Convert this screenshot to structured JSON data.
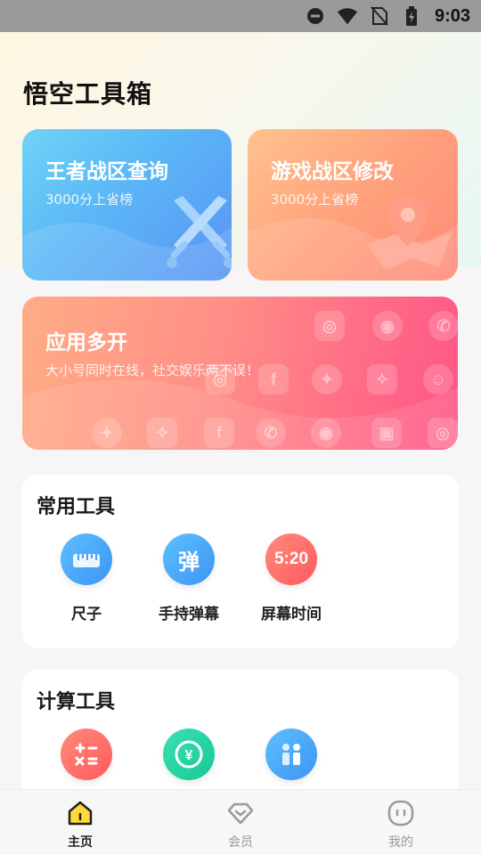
{
  "status_bar": {
    "time": "9:03"
  },
  "app": {
    "title": "悟空工具箱"
  },
  "cards": {
    "king": {
      "title": "王者战区查询",
      "subtitle": "3000分上省榜"
    },
    "game": {
      "title": "游戏战区修改",
      "subtitle": "3000分上省榜"
    },
    "multi": {
      "title": "应用多开",
      "subtitle": "大小号同时在线，社交娱乐两不误！"
    }
  },
  "sections": {
    "common": {
      "title": "常用工具",
      "tools": [
        {
          "label": "尺子",
          "icon": "ruler-icon",
          "color": "#4aa8f7"
        },
        {
          "label": "手持弹幕",
          "icon": "danmaku-icon",
          "color": "#3b9bf5",
          "glyph": "弹"
        },
        {
          "label": "屏幕时间",
          "icon": "clock-icon",
          "color": "#ff6464",
          "glyph": "5:20"
        }
      ]
    },
    "calc": {
      "title": "计算工具",
      "tools": [
        {
          "icon": "calculator-icon",
          "color": "#ff6464"
        },
        {
          "icon": "currency-exchange-icon",
          "color": "#25d4a2"
        },
        {
          "icon": "relative-calc-icon",
          "color": "#4aa8f7"
        }
      ]
    }
  },
  "tabbar": {
    "tabs": [
      {
        "label": "主页",
        "active": true
      },
      {
        "label": "会员",
        "active": false
      },
      {
        "label": "我的",
        "active": false
      }
    ]
  }
}
